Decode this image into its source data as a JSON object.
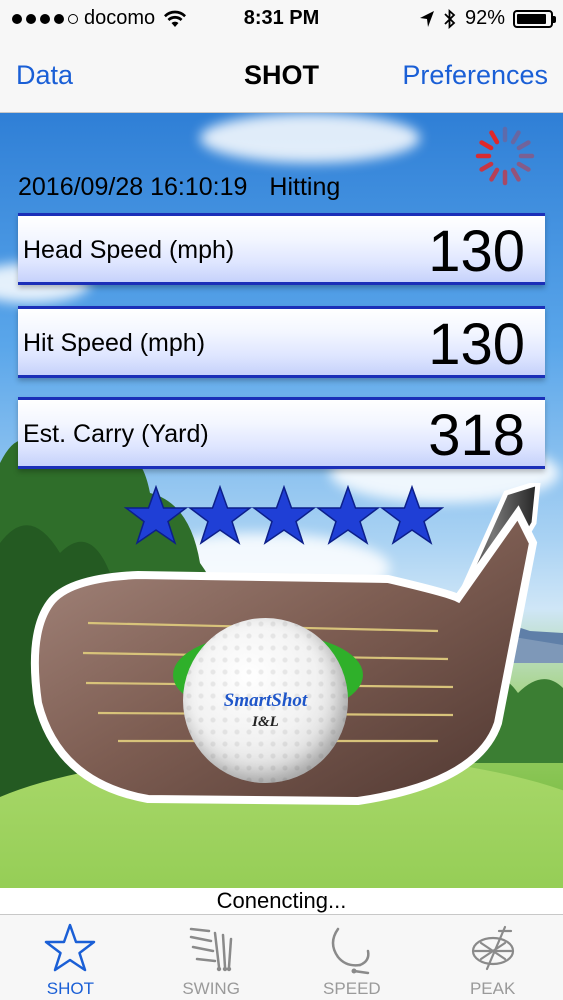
{
  "status_bar": {
    "carrier": "docomo",
    "time": "8:31 PM",
    "battery": "92%",
    "battery_level": 0.92
  },
  "nav": {
    "left": "Data",
    "title": "SHOT",
    "right": "Preferences"
  },
  "shot": {
    "datetime": "2016/09/28 16:10:19",
    "state": "Hitting",
    "metrics": [
      {
        "label": "Head Speed (mph)",
        "value": "130"
      },
      {
        "label": "Hit Speed (mph)",
        "value": "130"
      },
      {
        "label": "Est. Carry (Yard)",
        "value": "318"
      }
    ],
    "rating": 5,
    "ball_brand": "SmartShot",
    "ball_sub": "I&L"
  },
  "connection_status": "Conencting...",
  "tabs": [
    {
      "label": "SHOT",
      "icon": "star-icon",
      "active": true
    },
    {
      "label": "SWING",
      "icon": "swing-icon",
      "active": false
    },
    {
      "label": "SPEED",
      "icon": "speed-icon",
      "active": false
    },
    {
      "label": "PEAK",
      "icon": "peak-icon",
      "active": false
    }
  ],
  "colors": {
    "accent": "#1a5fd6",
    "metric_border": "#1b2fb8",
    "star": "#1f3fd6",
    "spinner": "#e0282a"
  }
}
